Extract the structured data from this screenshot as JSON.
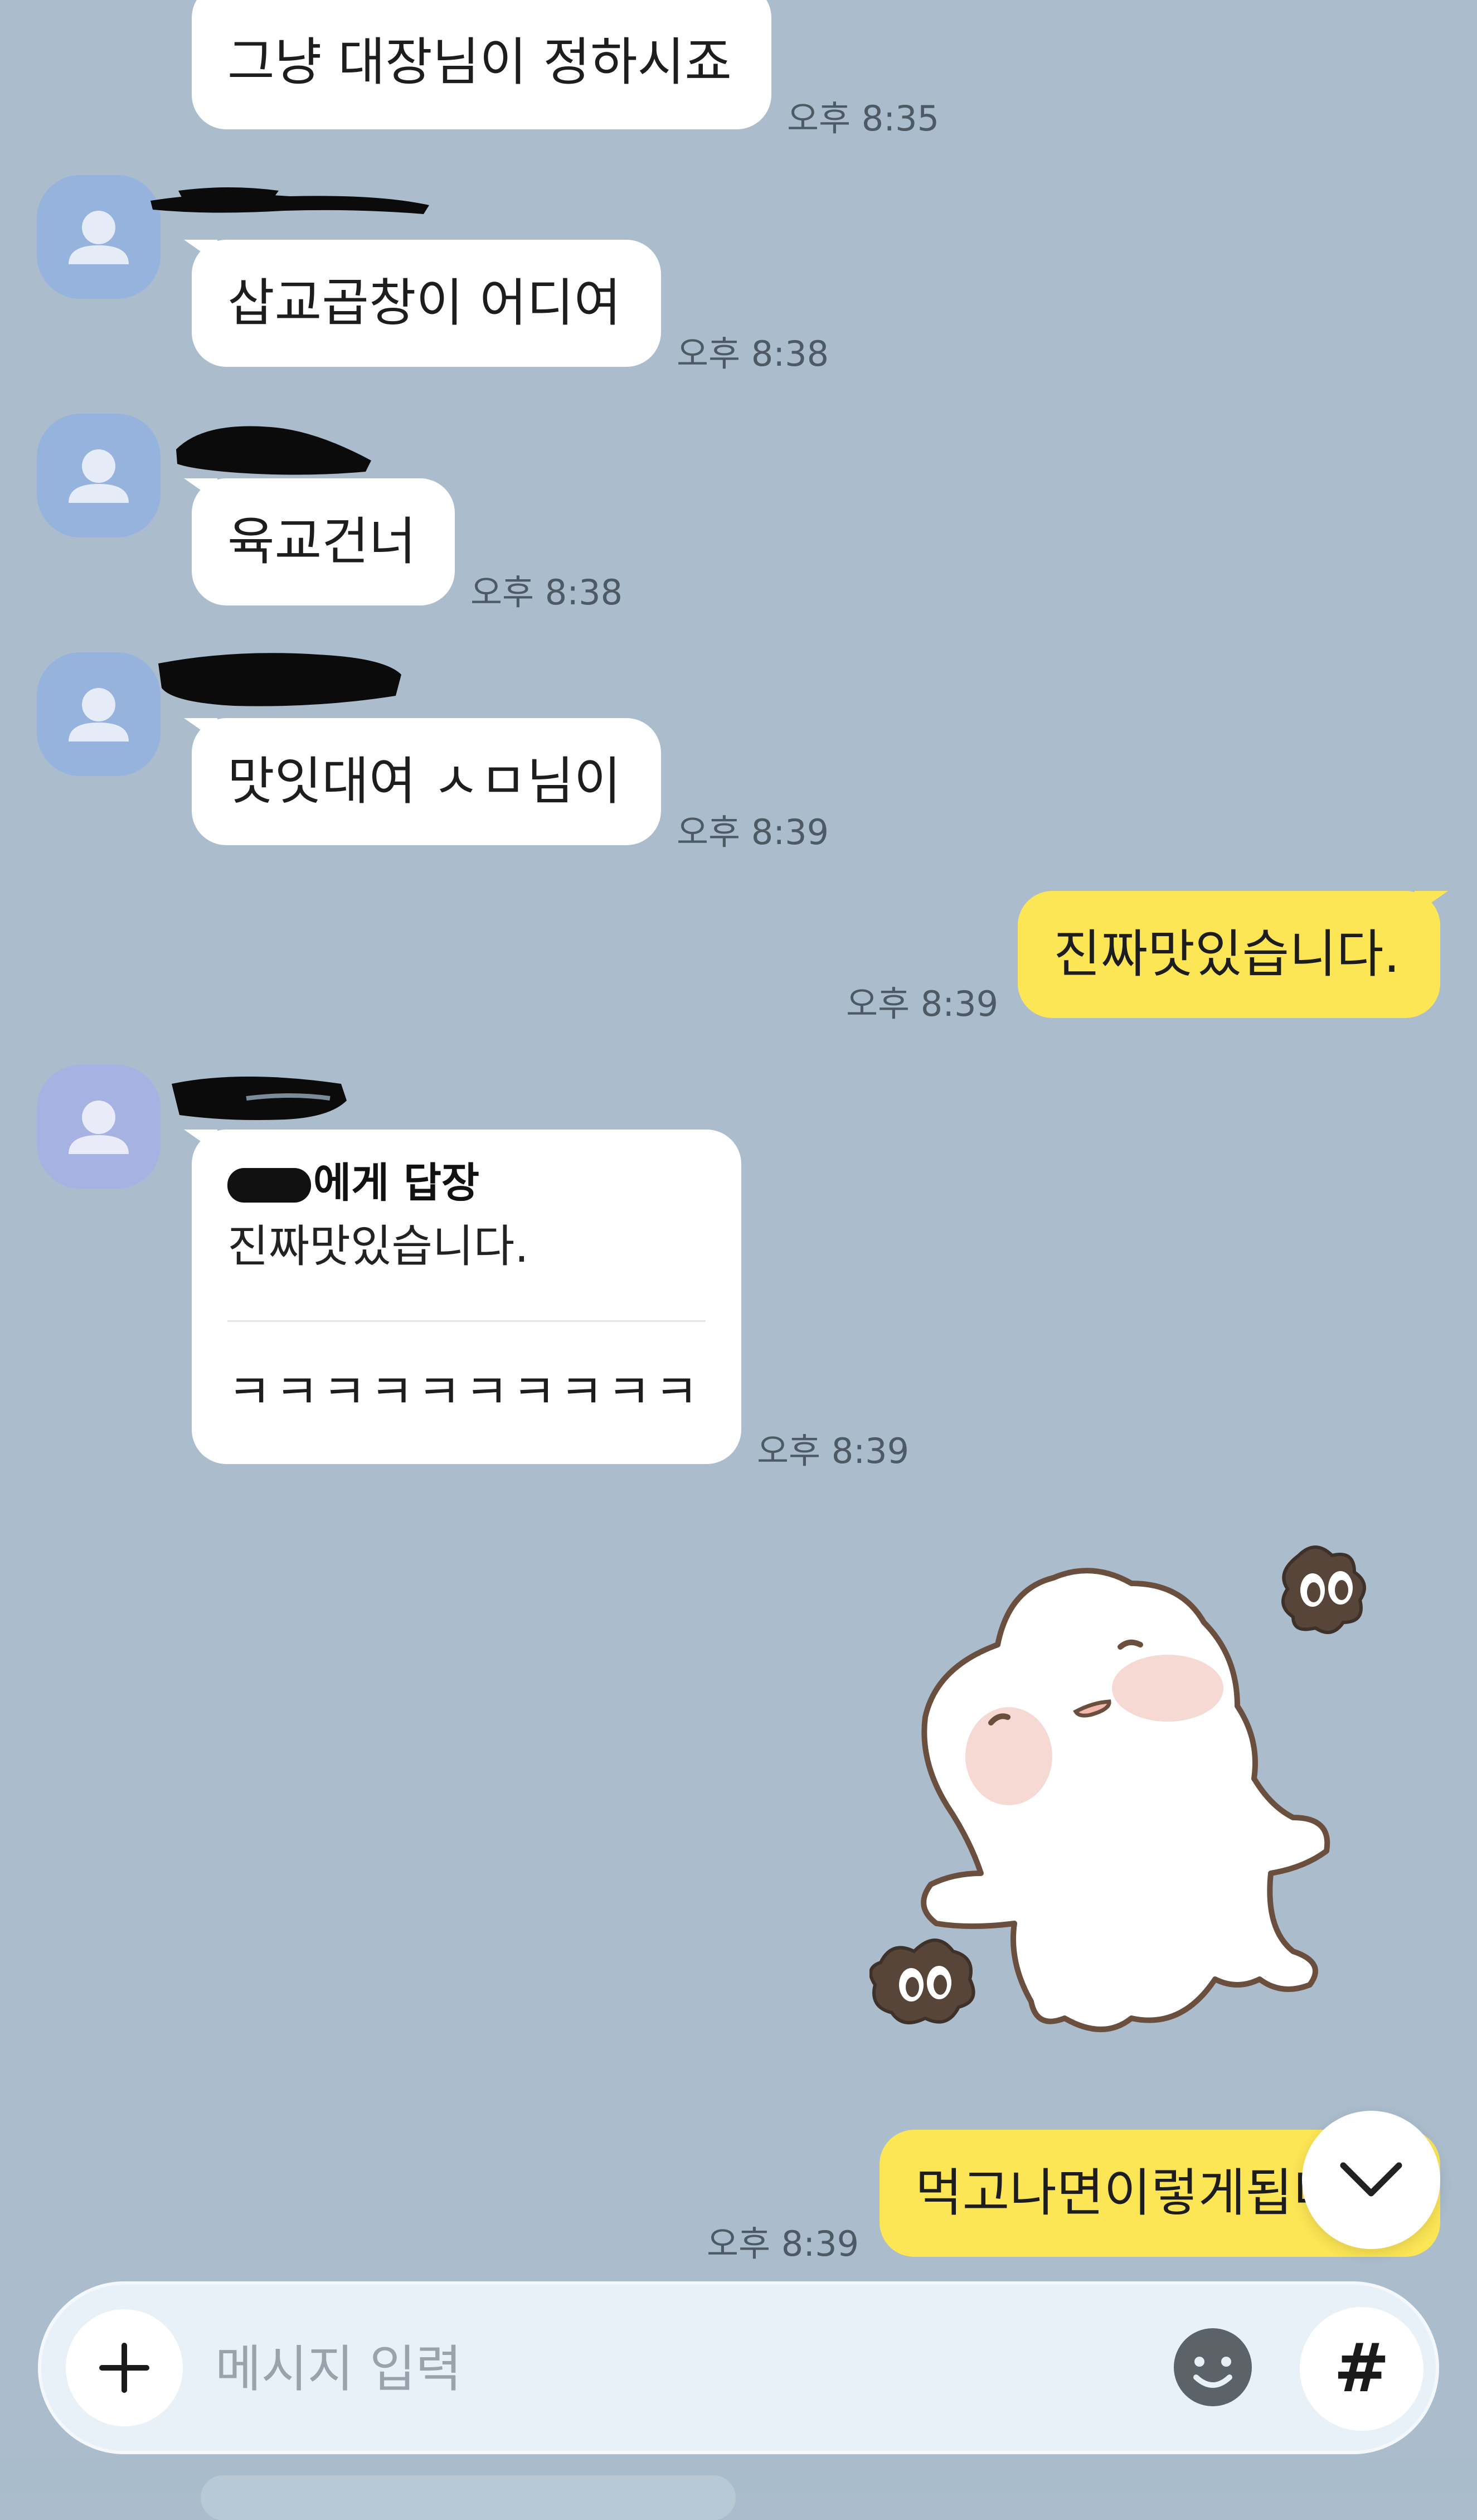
{
  "colors": {
    "background": "#abbdcd",
    "incoming_bubble": "#ffffff",
    "outgoing_bubble": "#fce655",
    "timestamp": "#4d5964",
    "input_bar": "#e8f0f8"
  },
  "messages": [
    {
      "side": "incoming",
      "text": "그냥 대장님이 정하시죠",
      "time": "오후 8:35",
      "sender_hidden": true
    },
    {
      "side": "incoming",
      "text": "삽교곱창이 어디여",
      "time": "오후 8:38",
      "sender_hidden": true
    },
    {
      "side": "incoming",
      "text": "육교건너",
      "time": "오후 8:38",
      "sender_hidden": true
    },
    {
      "side": "incoming",
      "text": "맛잇대여 ㅅㅁ님이",
      "time": "오후 8:39",
      "sender_hidden": true
    },
    {
      "side": "outgoing",
      "text": "진짜맛있습니다.",
      "time": "오후 8:39"
    },
    {
      "side": "incoming",
      "type": "reply",
      "time": "오후 8:39",
      "sender_hidden": true,
      "reply_header": "에게 답장",
      "reply_quote": "진짜맛있습니다.",
      "text": "ㅋㅋㅋㅋㅋㅋㅋㅋㅋㅋ"
    },
    {
      "side": "outgoing",
      "type": "sticker",
      "sticker_icon": "white-blob-character-sticker"
    },
    {
      "side": "outgoing",
      "text": "먹고나면이렇게됩니",
      "time": "오후 8:39"
    }
  ],
  "input": {
    "placeholder": "메시지 입력",
    "value": "",
    "plus_icon": "plus-icon",
    "emoji_icon": "emoji-icon",
    "hash_label": "#"
  },
  "scroll_down_icon": "chevron-down-icon"
}
